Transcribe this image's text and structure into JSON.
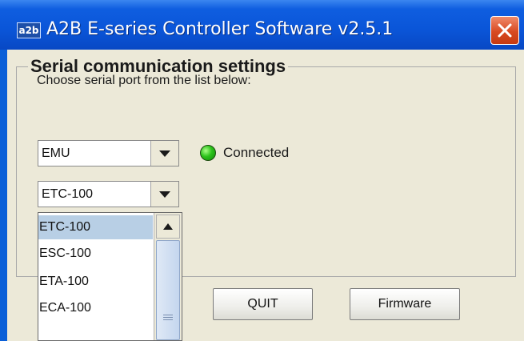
{
  "window": {
    "title": "A2B E-series Controller Software v2.5.1",
    "app_icon_text": "a2b",
    "close_icon": "close-x-icon"
  },
  "serial_settings": {
    "group_title": "Serial communication settings",
    "instruction": "Choose serial port from the list below:"
  },
  "device_combo": {
    "value": "EMU",
    "dropdown_icon": "chevron-down-icon"
  },
  "connection": {
    "status_text": "Connected",
    "indicator_color": "#22b014"
  },
  "model_combo": {
    "value": "ETC-100",
    "dropdown_icon": "chevron-down-icon",
    "options": [
      "ETC-100",
      "ESC-100",
      "ETA-100",
      "ECA-100"
    ],
    "selected_index": 0
  },
  "buttons": {
    "quit": "QUIT",
    "firmware": "Firmware"
  },
  "colors": {
    "titlebar": "#0a55d8",
    "panel": "#ece9d8",
    "list_selection": "#b8cfe5",
    "close_button": "#d84a22"
  }
}
